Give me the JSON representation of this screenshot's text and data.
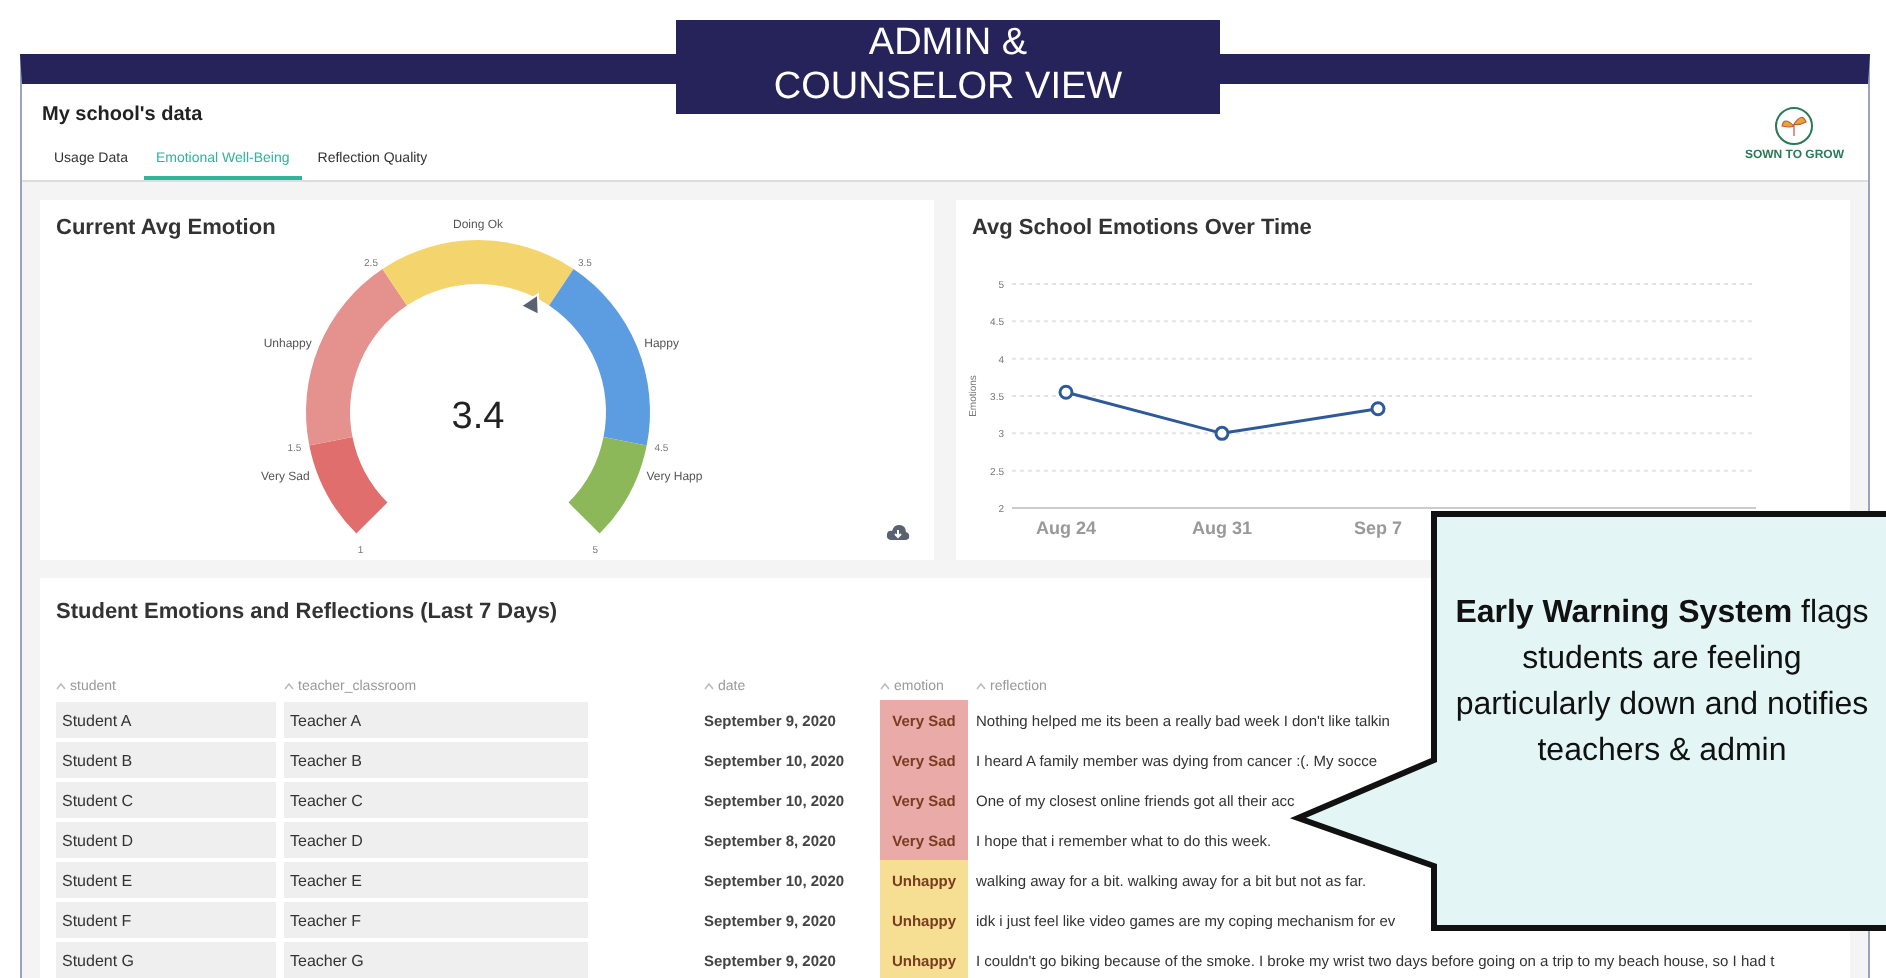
{
  "banner": {
    "text": "ADMIN & COUNSELOR VIEW"
  },
  "header": {
    "title": "My school's data",
    "logo_text": "SOWN TO GROW"
  },
  "tabs": [
    {
      "label": "Usage Data",
      "selected": false
    },
    {
      "label": "Emotional Well-Being",
      "selected": true
    },
    {
      "label": "Reflection Quality",
      "selected": false
    }
  ],
  "gauge_card": {
    "title": "Current Avg Emotion",
    "value": "3.4",
    "level": 0.6,
    "ticks": [
      "1",
      "1.5",
      "2.5",
      "3.5",
      "4.5",
      "5"
    ],
    "bands": [
      {
        "label": "Very Sad",
        "color": "#e06e6c"
      },
      {
        "label": "Unhappy",
        "color": "#e5918d"
      },
      {
        "label": "Doing Ok",
        "color": "#f4d46c"
      },
      {
        "label": "Happy",
        "color": "#5c9ce0"
      },
      {
        "label": "Very Happ",
        "color": "#8cb85a"
      }
    ]
  },
  "trend_card": {
    "title": "Avg School Emotions Over Time",
    "chart_data": {
      "type": "line",
      "ylabel": "Emotions",
      "categories": [
        "Aug 24",
        "Aug 31",
        "Sep 7"
      ],
      "series": [
        {
          "color": "#2f5a9a",
          "values": [
            3.55,
            3.0,
            3.33
          ]
        }
      ],
      "grid": true,
      "marker": true,
      "ylim": [
        2,
        5
      ],
      "yticks": [
        2,
        2.5,
        3,
        3.5,
        4,
        4.5,
        5
      ]
    }
  },
  "table": {
    "title": "Student Emotions and Reflections (Last 7 Days)",
    "columns": [
      "student",
      "teacher_classroom",
      "date",
      "emotion",
      "reflection"
    ],
    "rows": [
      {
        "student": "Student A",
        "teacher_classroom": "Teacher A",
        "date": "September 9, 2020",
        "emotion": "Very Sad",
        "color": "#eaaaa8",
        "reflection": "Nothing helped me its been a really bad week I don't like talkin"
      },
      {
        "student": "Student B",
        "teacher_classroom": "Teacher B",
        "date": "September 10, 2020",
        "emotion": "Very Sad",
        "color": "#eaaaa8",
        "reflection": "I heard A family member was dying from cancer :(. My socce"
      },
      {
        "student": "Student C",
        "teacher_classroom": "Teacher C",
        "date": "September 10, 2020",
        "emotion": "Very Sad",
        "color": "#eaaaa8",
        "reflection": "One of my closest online friends got all their acc"
      },
      {
        "student": "Student D",
        "teacher_classroom": "Teacher D",
        "date": "September 8, 2020",
        "emotion": "Very Sad",
        "color": "#eaaaa8",
        "reflection": "I hope that i remember what to do this week."
      },
      {
        "student": "Student E",
        "teacher_classroom": "Teacher E",
        "date": "September 10, 2020",
        "emotion": "Unhappy",
        "color": "#f6de92",
        "reflection": "walking away for a bit. walking away for a bit but not as far."
      },
      {
        "student": "Student F",
        "teacher_classroom": "Teacher F",
        "date": "September 9, 2020",
        "emotion": "Unhappy",
        "color": "#f6de92",
        "reflection": "idk i just feel like video games are my coping mechanism for ev"
      },
      {
        "student": "Student G",
        "teacher_classroom": "Teacher G",
        "date": "September 9, 2020",
        "emotion": "Unhappy",
        "color": "#f6de92",
        "reflection": "I couldn't go biking because of the smoke. I broke my wrist two days before going on a trip to my beach house, so I had t"
      }
    ]
  },
  "callout": {
    "text": "**Early Warning System** flags students are feeling particularly down and notifies teachers & admin"
  }
}
